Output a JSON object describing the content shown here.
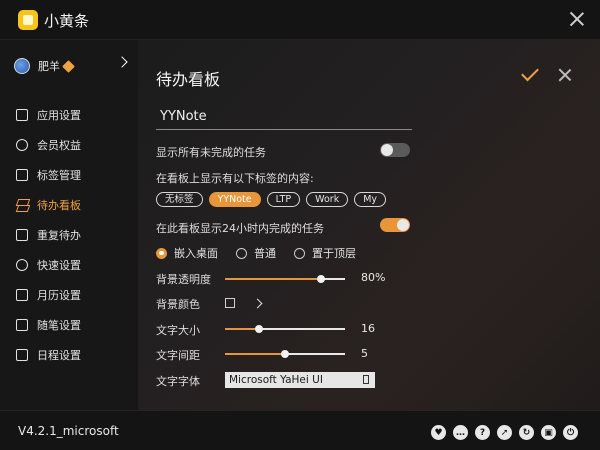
{
  "app": {
    "title": "小黄条"
  },
  "user": {
    "name": "肥羊"
  },
  "sidebar": {
    "items": [
      {
        "label": "应用设置",
        "icon": "cube-icon"
      },
      {
        "label": "会员权益",
        "icon": "circle-icon"
      },
      {
        "label": "标签管理",
        "icon": "tag-list-icon"
      },
      {
        "label": "待办看板",
        "icon": "layers-icon",
        "active": true
      },
      {
        "label": "重复待办",
        "icon": "repeat-icon"
      },
      {
        "label": "快速设置",
        "icon": "power-icon"
      },
      {
        "label": "月历设置",
        "icon": "calendar-icon"
      },
      {
        "label": "随笔设置",
        "icon": "note-icon"
      },
      {
        "label": "日程设置",
        "icon": "schedule-icon"
      }
    ]
  },
  "panel": {
    "title": "待办看板",
    "board_name": "YYNote",
    "show_unfinished_label": "显示所有未完成的任务",
    "show_unfinished_on": false,
    "tag_filter_label": "在看板上显示有以下标签的内容:",
    "tags": [
      {
        "label": "无标签",
        "selected": false
      },
      {
        "label": "YYNote",
        "selected": true
      },
      {
        "label": "LTP",
        "selected": false
      },
      {
        "label": "Work",
        "selected": false
      },
      {
        "label": "My",
        "selected": false
      }
    ],
    "show_completed_label": "在此看板显示24小时内完成的任务",
    "show_completed_on": true,
    "position_options": [
      {
        "label": "嵌入桌面",
        "checked": true
      },
      {
        "label": "普通",
        "checked": false
      },
      {
        "label": "置于顶层",
        "checked": false
      }
    ],
    "opacity": {
      "label": "背景透明度",
      "value": 80,
      "value_text": "80%"
    },
    "bg_color": {
      "label": "背景颜色"
    },
    "font_size": {
      "label": "文字大小",
      "value": 16,
      "min": 8,
      "max": 36,
      "value_text": "16"
    },
    "line_spacing": {
      "label": "文字间距",
      "value": 5,
      "min": 0,
      "max": 10,
      "value_text": "5"
    },
    "font_family": {
      "label": "文字字体",
      "value": "Microsoft YaHei UI"
    }
  },
  "footer": {
    "version": "V4.2.1_microsoft",
    "icons": [
      "heart-icon",
      "chat-icon",
      "help-icon",
      "share-icon",
      "refresh-icon",
      "info-icon",
      "power-icon"
    ]
  },
  "colors": {
    "accent": "#e8963a",
    "background": "#1b1b1b"
  }
}
